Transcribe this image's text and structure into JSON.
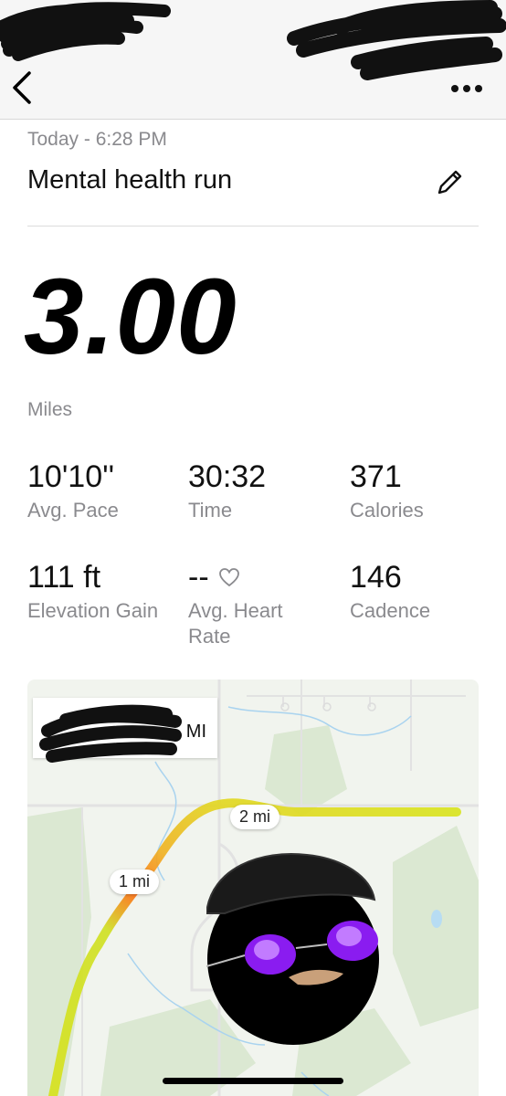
{
  "header": {
    "back_icon": "chevron-left-icon",
    "more_icon": "ellipsis-icon"
  },
  "activity": {
    "when": "Today - 6:28 PM",
    "name": "Mental health run",
    "edit_icon": "pencil-icon"
  },
  "summary": {
    "distance": "3.00",
    "distance_unit": "Miles"
  },
  "stats": [
    {
      "value": "10'10''",
      "label": "Avg. Pace"
    },
    {
      "value": "30:32",
      "label": "Time"
    },
    {
      "value": "371",
      "label": "Calories"
    },
    {
      "value": "111 ft",
      "label": "Elevation Gain"
    },
    {
      "value": "--",
      "label": "Avg. Heart Rate",
      "icon": "heart-outline-icon"
    },
    {
      "value": "146",
      "label": "Cadence"
    }
  ],
  "map": {
    "location_suffix": "MI",
    "markers": [
      {
        "label": "1 mi"
      },
      {
        "label": "2 mi"
      }
    ]
  },
  "colors": {
    "route_start": "#d6e21a",
    "route_fast": "#f0b020",
    "route_peak": "#ff6a10",
    "secondary_text": "#8a8a8e"
  }
}
